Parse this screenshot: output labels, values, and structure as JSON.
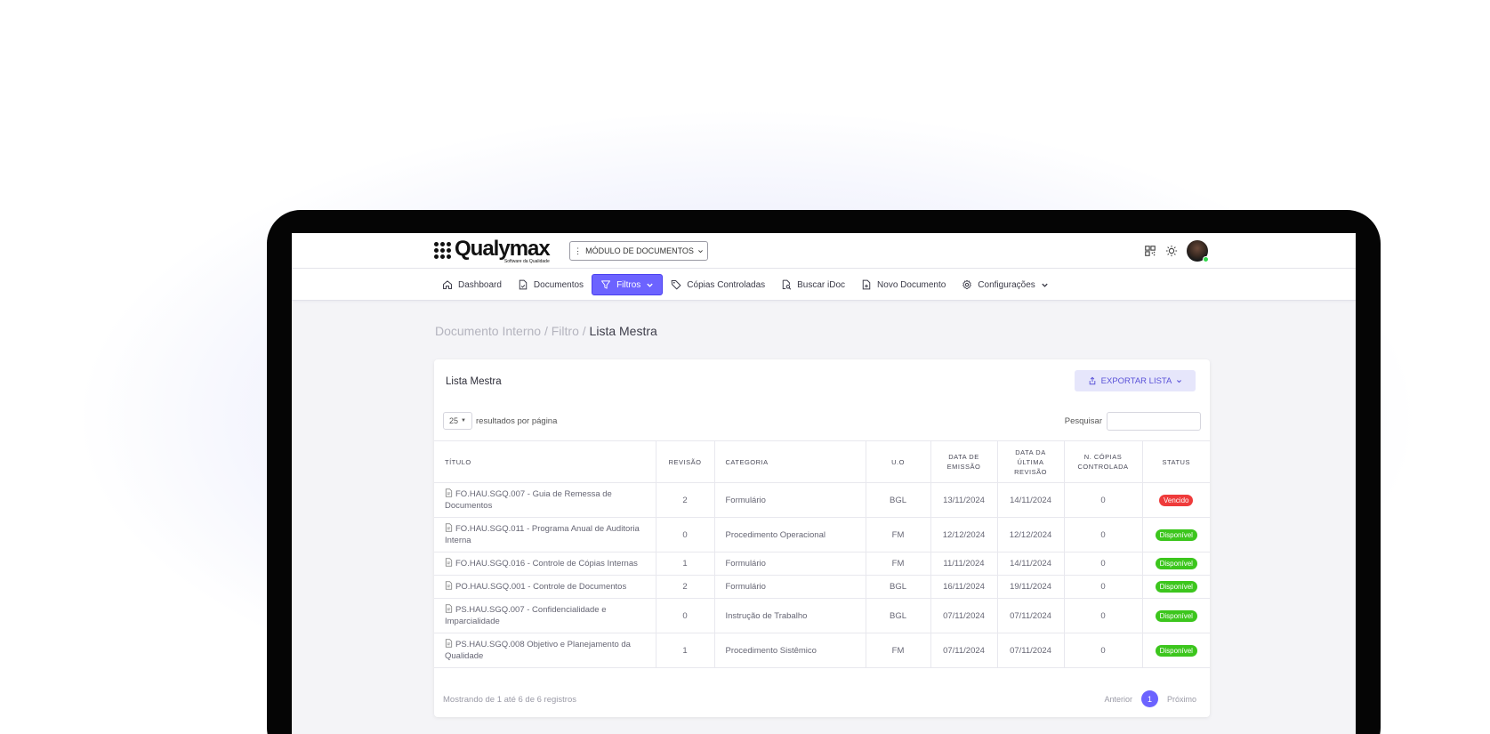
{
  "app": {
    "logo_name": "Qualymax",
    "logo_subtitle": "Software da Qualidade",
    "module_button": "MÓDULO DE DOCUMENTOS"
  },
  "nav": {
    "items": [
      {
        "label": "Dashboard",
        "icon": "home-icon",
        "active": false
      },
      {
        "label": "Documentos",
        "icon": "document-check-icon",
        "active": false
      },
      {
        "label": "Filtros",
        "icon": "filter-icon",
        "active": true
      },
      {
        "label": "Cópias Controladas",
        "icon": "tag-icon",
        "active": false
      },
      {
        "label": "Buscar iDoc",
        "icon": "search-doc-icon",
        "active": false
      },
      {
        "label": "Novo Documento",
        "icon": "document-add-icon",
        "active": false
      },
      {
        "label": "Configurações",
        "icon": "gear-icon",
        "active": false
      }
    ]
  },
  "breadcrumb": {
    "part1": "Documento Interno",
    "sep1": " / ",
    "part2": "Filtro",
    "sep2": " / ",
    "current": "Lista Mestra"
  },
  "card": {
    "title": "Lista Mestra",
    "export_label": "EXPORTAR LISTA",
    "per_page_value": "25",
    "per_page_label": "resultados por página",
    "search_label": "Pesquisar",
    "search_value": ""
  },
  "table": {
    "headers": {
      "titulo": "TÍTULO",
      "revisao": "REVISÃO",
      "categoria": "CATEGORIA",
      "uo": "U.O",
      "emissao_1": "DATA DE",
      "emissao_2": "EMISSÃO",
      "ultima_1": "DATA DA",
      "ultima_2": "ÚLTIMA",
      "ultima_3": "REVISÃO",
      "copias_1": "N. CÓPIAS",
      "copias_2": "CONTROLADA",
      "status": "STATUS"
    },
    "rows": [
      {
        "titulo": "FO.HAU.SGQ.007 - Guia de Remessa de Documentos",
        "revisao": "2",
        "categoria": "Formulário",
        "uo": "BGL",
        "emissao": "13/11/2024",
        "ultima": "14/11/2024",
        "copias": "0",
        "status": "Vencido"
      },
      {
        "titulo": "FO.HAU.SGQ.011 - Programa Anual de Auditoria Interna",
        "revisao": "0",
        "categoria": "Procedimento Operacional",
        "uo": "FM",
        "emissao": "12/12/2024",
        "ultima": "12/12/2024",
        "copias": "0",
        "status": "Disponível"
      },
      {
        "titulo": "FO.HAU.SGQ.016 - Controle de Cópias Internas",
        "revisao": "1",
        "categoria": "Formulário",
        "uo": "FM",
        "emissao": "11/11/2024",
        "ultima": "14/11/2024",
        "copias": "0",
        "status": "Disponível"
      },
      {
        "titulo": "PO.HAU.SGQ.001 - Controle de Documentos",
        "revisao": "2",
        "categoria": "Formulário",
        "uo": "BGL",
        "emissao": "16/11/2024",
        "ultima": "19/11/2024",
        "copias": "0",
        "status": "Disponível"
      },
      {
        "titulo": "PS.HAU.SGQ.007 - Confidencialidade e Imparcialidade",
        "revisao": "0",
        "categoria": "Instrução de Trabalho",
        "uo": "BGL",
        "emissao": "07/11/2024",
        "ultima": "07/11/2024",
        "copias": "0",
        "status": "Disponível"
      },
      {
        "titulo": "PS.HAU.SGQ.008 Objetivo e Planejamento da Qualidade",
        "revisao": "1",
        "categoria": "Procedimento Sistêmico",
        "uo": "FM",
        "emissao": "07/11/2024",
        "ultima": "07/11/2024",
        "copias": "0",
        "status": "Disponível"
      }
    ]
  },
  "footer": {
    "info": "Mostrando de 1 até 6 de 6 registros",
    "prev": "Anterior",
    "page": "1",
    "next": "Próximo"
  },
  "colors": {
    "accent": "#6c63ff",
    "status_vencido": "#ef3b3b",
    "status_disponivel": "#3cc61d"
  }
}
